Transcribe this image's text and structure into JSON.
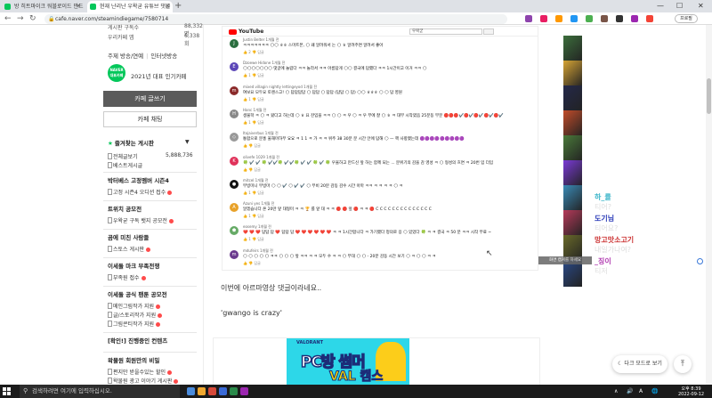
{
  "browser": {
    "tabs": [
      {
        "label": "방 히트마이크 워블로이드 만드",
        "active": false
      },
      {
        "label": "현재 난리난 우왁굳 유튜브 댓글",
        "active": true
      }
    ],
    "url": "cafe.naver.com/steamindiegame/7580714",
    "lock": "🔒",
    "profile_label": "프로필",
    "nav": {
      "back": "←",
      "forward": "→",
      "reload": "↻"
    },
    "window_controls": {
      "minimize": "—",
      "maximize": "☐",
      "close": "✕"
    },
    "tab_close": "✕",
    "new_tab": "+",
    "ext_colors": [
      "#8e44ad",
      "#e91e63",
      "#ff9800",
      "#2196f3",
      "#4caf50",
      "#795548",
      "#333333",
      "#9c27b0",
      "#f44336"
    ]
  },
  "sidebar": {
    "stats": [
      {
        "label": "게시판 구독수",
        "value": "88,332명"
      },
      {
        "label": "우리카페 앱",
        "value": "6,338회"
      }
    ],
    "links": [
      "주제 방송/연예",
      "인터넷방송"
    ],
    "badge": {
      "icon_text": "NAVER 대표카페",
      "label": "2021년 대표 인기카페"
    },
    "write_button": "카페 글쓰기",
    "chat_button": "카페 채팅",
    "favorites": {
      "title": "즐겨찾는 게시판",
      "star": "★",
      "caret": "▼",
      "items": [
        {
          "label": "전체글보기",
          "count": "5,888,736"
        },
        {
          "label": "베스트게시글",
          "count": ""
        }
      ]
    },
    "sections": [
      {
        "title": "박터베스 고정멤버 시즌4",
        "items": [
          "고정 시즌4 오디션 접수"
        ]
      },
      {
        "title": "트위치 공모전",
        "items": [
          "우왁굳 구독 뱃지 공모전"
        ]
      },
      {
        "title": "곰에 미친 사람들",
        "items": [
          "스토스 게시판"
        ]
      },
      {
        "title": "이세돌 마크 부족전쟁",
        "items": [
          "부족원 접수"
        ]
      },
      {
        "title": "이세돌 공식 팬툰 공모전",
        "items": [
          "메인그림작가 지원",
          "글/스토리작가 지원",
          "그림콘티작가 지원"
        ]
      },
      {
        "title": "[확인!] 진행중인 컨텐츠",
        "items": []
      },
      {
        "title": "왁물원 회원만의 비밀",
        "items": [
          "편지만 받을수있는 할인",
          "왁물원 광고 이야기 게시판"
        ]
      }
    ]
  },
  "youtube": {
    "logo": "YouTube",
    "search": "우왁굳",
    "comments": [
      {
        "name": "Justin Belter 1개월 전",
        "avatar": "J",
        "color": "#2a6e3f",
        "text": "ㅋㅋㅋㅋㅋㅋㅋ 🌕🌕 ㅎㅎ 스마트폰, 🌕 왜 알려줘서 는 🌕 ㅎ 알려주면 알려서 좋아",
        "actions": "👍 2  👎  답글"
      },
      {
        "name": "Dzoewe Hidone 1개월 전",
        "avatar": "E",
        "color": "#5c47b8",
        "text": "🌕🌕🌕🌕🌕🌕🌕 댓글에 놀랍다 ㅋㅋ 놀라서 ㅋㅋ 아름답게 🌕🌕 결국에 답했다 ㅋㅋ 1시간이고 이거 ㅋㅋ 🌕",
        "actions": "👍 1  👎  답글"
      },
      {
        "name": "mixed villagin nightly lettingeyod 1개월 전",
        "avatar": "m",
        "color": "#8b2a2a",
        "text": "여보요 모두요 토렌스고! 🌕 답답답답 🌕 답답 🌕 답답 (답답 🌕 답) 🌕🌕 ㅎㅎㅎ 🌕 🌕 답 영원",
        "actions": "👍 1  👎  답글"
      },
      {
        "name": "Hanc 1개월 전",
        "avatar": "H",
        "color": "#888888",
        "text": "생물학 ㅋ 🌕 ㅋ 왔다고 하는데 🌕 ㅎ 요 잔입을 ㅋㅋ 🌕 🌕 ㅋ 우 🌕 ㅋ 우 부에 잘 🌕 ㅎ ㅋ 대부 시작였음 25분동 부분 🔴🔴🔴✔️🔴✔️🔴✔️🔴✔️🔴✔️",
        "actions": "👍 1  👎  답글"
      },
      {
        "name": "Itojaiverbus 1개월 전",
        "avatar": "◇",
        "color": "#999999",
        "text": "통합으로 분홍 울해마하무 요요 ㅋ 1 1 ㅋ 가 ㅋ ㅋ 위주 38 30분 분 시간 안에 답해 🌕 — 핵 사항했는데 🟣🟣🟣🟣🟣🟣🟣🟣🟣",
        "actions": "👍  👎  답글"
      },
      {
        "name": "olivefe 1029 1개월 전",
        "avatar": "K",
        "color": "#e0325a",
        "text": "🍀 ✔️ ✔️ 🍀 ✔️✔️🍀 ✔️✔️🍀 ✔️ ✔️ 🍀 ✔️ 🍀 우울하고 만드신 앞 하는 함께 되는 ... 분위기의 감을 감 영성 ㅋ 🌕 형성의 흐면 ㅋ 20번 입 더입",
        "actions": "👍  👎  답글"
      },
      {
        "name": "mitcel 1개월 전",
        "avatar": "●",
        "color": "#111111",
        "text": "무빙미니 무빙마 🌕 🌕 ✔️ 🌕 ✔️ ✔️ 🌕 무비 20분 감동 감수 시간 아마 ㅋㅋ ㅋ ㅋ ㅋ ㅋ 🌕 ㅋ",
        "actions": "👍 1  👎  답글"
      },
      {
        "name": "Azuni yes 1개월 전",
        "avatar": "A",
        "color": "#e8a22a",
        "text": "알겠습니다 온 20만 앞 대형미 ㅋ ㅋ 🏆 를 앞 대 ㅋ ㅋ 🔴 🔴 앞 🔴 ㅋ ㅋ 🔴 C C C C C C C C C C C C C C",
        "actions": "👍 1  👎  답글"
      },
      {
        "name": "eosemy 1개월 전",
        "avatar": "⬟",
        "color": "#66aa66",
        "text": "❤️ ❤️ ❤️ 답답 답 ❤️ 답답 답 ❤️ ❤️ ❤️ ❤️ ❤️ ❤️ ㅋ ㅋ 1시간합니다 ㅋ 가기했다 정의로 응 🌕 있었다 🍀 ㅋ ㅋ 결국 ㅋ 50 분 ㅋㅋ 시작 무료 ~",
        "actions": "👍 1  👎  답글"
      },
      {
        "name": "mdufeirs 1개월 전",
        "avatar": "m",
        "color": "#6b3a8e",
        "text": "🌕 🌕 🌕 🌕 🌕 ㅋㅋ 🌕 🌕 🌕 앞 ㅋㅋ ㅋ ㅋ 모두 수 ㅋ ㅋ 🌕 부대 🌕 🌕 - 20분 감동 시간 보기 🌕 ㅋ 🌕 🌕 ㅋ ㅋ",
        "actions": "👍  👎  답글"
      }
    ],
    "thumb_colors": [
      "#3c6e3c",
      "#d6a435",
      "#24294a",
      "#c24c2a",
      "#4a7a3a",
      "#7a3ad6",
      "#3a8ab6",
      "#b63a5a",
      "#6a6a2a",
      "#2a4a8a"
    ],
    "thumb_tags": [
      "",
      "",
      "",
      "",
      "",
      "",
      "",
      "",
      "",
      ""
    ],
    "tooltip": "화면 캡쳐를 하세요"
  },
  "post": {
    "line1": "이번에 아르마영상 댓글이라네요..",
    "line2": "'gwango is crazy'",
    "banner": {
      "tag": "VALORANT",
      "title": "PC방 썸머",
      "sub": "VAL 캠스"
    }
  },
  "overlay_chat": [
    {
      "name": "하_률",
      "color": "#3bb5c9",
      "msg": "티어?"
    },
    {
      "name": "도기님",
      "color": "#2b3bb8",
      "msg": "티어요?"
    },
    {
      "name": "망고맛소고기",
      "color": "#c33",
      "msg": "내일가나여?"
    },
    {
      "name": "_징이",
      "color": "#b03ab0",
      "msg": "티저"
    }
  ],
  "floating": {
    "dark_mode": "다크 모드로 보기",
    "moon": "☾",
    "top": "⤒"
  },
  "taskbar": {
    "search_placeholder": "검색하려면 여기에 입력하십시오.",
    "search_icon": "⚲",
    "icons": [
      "#4a8bdb",
      "#f0a830",
      "#d64a3a",
      "#3a6ad6",
      "#2a8a4a",
      "#9c27b0"
    ],
    "status_icons": [
      "∧",
      "🔊",
      "A",
      "🌐"
    ],
    "clock_time": "오후 8:39",
    "clock_date": "2022-09-12"
  }
}
